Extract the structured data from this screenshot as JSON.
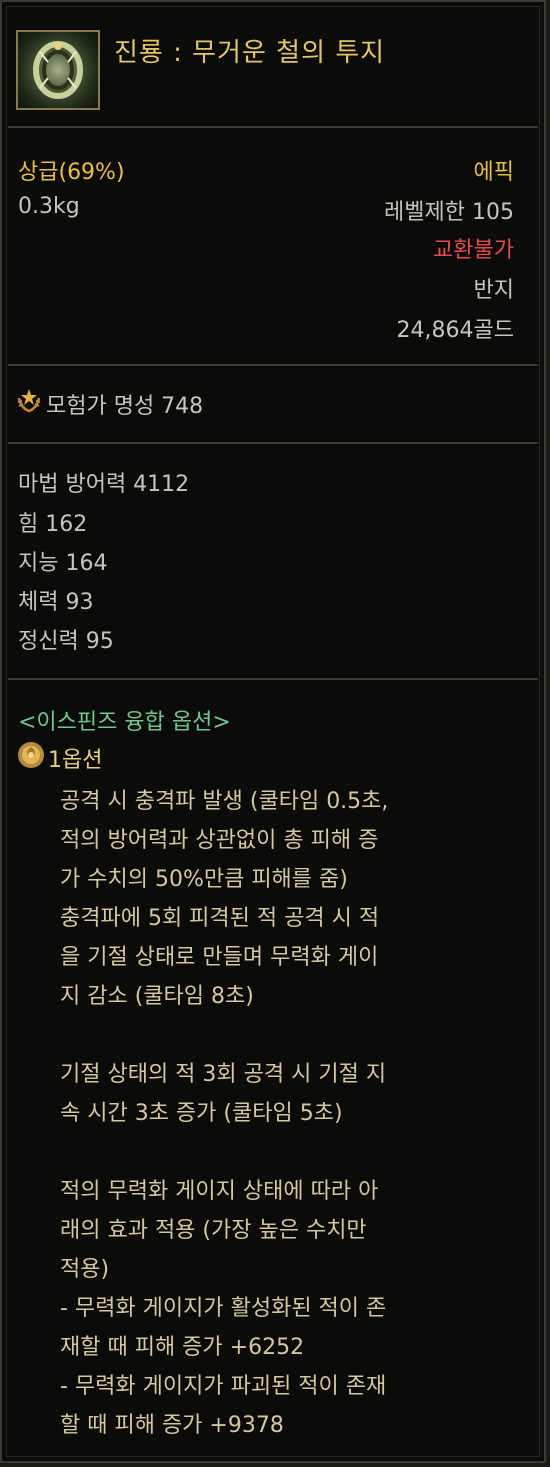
{
  "item": {
    "name": "진룡 : 무거운 철의 투지",
    "grade": "상급(69%)",
    "weight": "0.3kg",
    "rarity": "에픽",
    "level_limit": "레벨제한 105",
    "trade": "교환불가",
    "type": "반지",
    "price": "24,864골드"
  },
  "fame": {
    "label": "모험가 명성 748",
    "icon": "fame-laurel-icon"
  },
  "stats": [
    "마법 방어력 4112",
    "힘 162",
    "지능 164",
    "체력 93",
    "정신력 95"
  ],
  "fusion": {
    "header": "<이스핀즈 융합 옵션>",
    "option_label": "1옵션",
    "option_icon": "rose-emblem-icon",
    "lines": [
      "공격 시 충격파 발생 (쿨타임 0.5초,",
      "적의 방어력과 상관없이 총 피해 증",
      "가 수치의 50%만큼 피해를 줌)",
      "충격파에 5회 피격된 적 공격 시 적",
      "을 기절 상태로 만들며 무력화 게이",
      "지 감소 (쿨타임 8초)",
      "",
      "기절 상태의 적 3회 공격 시 기절 지",
      "속 시간 3초 증가 (쿨타임 5초)",
      "",
      "적의 무력화 게이지 상태에 따라 아",
      "래의 효과 적용 (가장 높은 수치만",
      "적용)",
      "- 무력화 게이지가 활성화된 적이 존",
      "재할 때 피해 증가 +6252",
      "- 무력화 게이지가 파괴된 적이 존재",
      "할 때 피해 증가 +9378"
    ]
  },
  "colors": {
    "title": "#e6c65d",
    "rarity_epic": "#e9c23a",
    "untradable": "#e44b4b",
    "fusion_header": "#6cc98a",
    "body_text": "#ccc3a3"
  }
}
